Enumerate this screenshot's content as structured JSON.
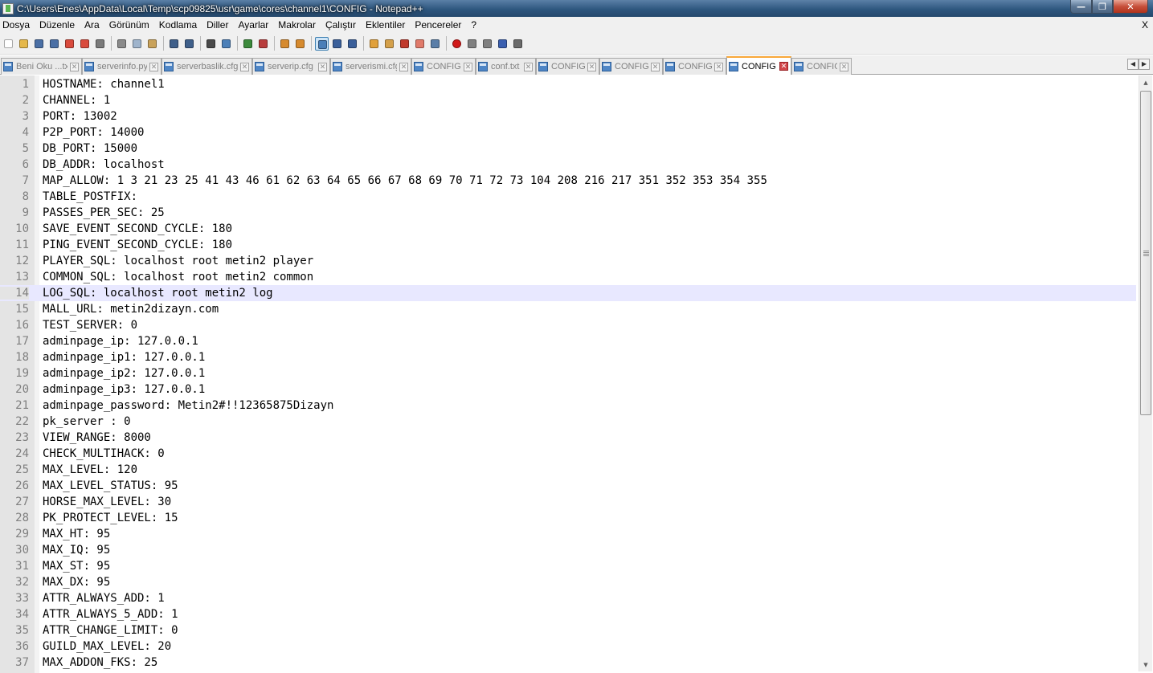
{
  "window": {
    "title": "C:\\Users\\Enes\\AppData\\Local\\Temp\\scp09825\\usr\\game\\cores\\channel1\\CONFIG - Notepad++",
    "app_icon": "notepadpp-icon"
  },
  "menu": {
    "items": [
      "Dosya",
      "Düzenle",
      "Ara",
      "Görünüm",
      "Kodlama",
      "Diller",
      "Ayarlar",
      "Makrolar",
      "Çalıştır",
      "Eklentiler",
      "Pencereler",
      "?"
    ],
    "close_label": "X"
  },
  "toolbar": {
    "buttons": [
      {
        "name": "new-file-icon",
        "color": "#ffffff"
      },
      {
        "name": "open-file-icon",
        "color": "#e5b84a"
      },
      {
        "name": "save-icon",
        "color": "#4a6fa5"
      },
      {
        "name": "save-all-icon",
        "color": "#4a6fa5"
      },
      {
        "name": "close-icon",
        "color": "#d94a3c"
      },
      {
        "name": "close-all-icon",
        "color": "#d94a3c"
      },
      {
        "name": "print-icon",
        "color": "#7a7a7a"
      },
      {
        "name": "cut-icon",
        "color": "#8a8a8a"
      },
      {
        "name": "copy-icon",
        "color": "#9fb4cc"
      },
      {
        "name": "paste-icon",
        "color": "#c9a25a"
      },
      {
        "name": "undo-icon",
        "color": "#3f5f8a"
      },
      {
        "name": "redo-icon",
        "color": "#3f5f8a"
      },
      {
        "name": "find-icon",
        "color": "#4a4a4a"
      },
      {
        "name": "replace-icon",
        "color": "#4b7fb8"
      },
      {
        "name": "zoom-in-icon",
        "color": "#3c8a3c"
      },
      {
        "name": "zoom-out-icon",
        "color": "#b83c3c"
      },
      {
        "name": "sync-vertical-icon",
        "color": "#d68a2e"
      },
      {
        "name": "sync-horizontal-icon",
        "color": "#d68a2e"
      },
      {
        "name": "word-wrap-icon",
        "color": "#4b7fb8"
      },
      {
        "name": "show-all-chars-icon",
        "color": "#3a5f9a"
      },
      {
        "name": "indent-guide-icon",
        "color": "#3a5f9a"
      },
      {
        "name": "user-lang-icon",
        "color": "#e0a03a"
      },
      {
        "name": "doc-map-icon",
        "color": "#d4a04a"
      },
      {
        "name": "function-list-icon",
        "color": "#c0392b"
      },
      {
        "name": "folder-workspace-icon",
        "color": "#e07a6a"
      },
      {
        "name": "monitoring-eye-icon",
        "color": "#5a7ea8"
      },
      {
        "name": "macro-record-icon",
        "color": "#d01818"
      },
      {
        "name": "macro-stop-icon",
        "color": "#808080"
      },
      {
        "name": "macro-play-icon",
        "color": "#808080"
      },
      {
        "name": "macro-run-multiple-icon",
        "color": "#3a5fb0"
      },
      {
        "name": "macro-save-icon",
        "color": "#6a6a6a"
      }
    ]
  },
  "tabs": [
    {
      "label": "Beni Oku ...txt",
      "active": false
    },
    {
      "label": "serverinfo.py",
      "active": false
    },
    {
      "label": "serverbaslik.cfg",
      "active": false
    },
    {
      "label": "serverip.cfg",
      "active": false
    },
    {
      "label": "serverismi.cfg",
      "active": false
    },
    {
      "label": "CONFIG",
      "active": false
    },
    {
      "label": "conf.txt",
      "active": false
    },
    {
      "label": "CONFIG",
      "active": false
    },
    {
      "label": "CONFIG",
      "active": false
    },
    {
      "label": "CONFIG",
      "active": false
    },
    {
      "label": "CONFIG",
      "active": true
    },
    {
      "label": "CONFIG",
      "active": false
    }
  ],
  "tab_widths": [
    101,
    99,
    113,
    97,
    101,
    80,
    75,
    79,
    79,
    79,
    81,
    75
  ],
  "editor": {
    "current_line": 14,
    "lines": [
      "HOSTNAME: channel1",
      "CHANNEL: 1",
      "PORT: 13002",
      "P2P_PORT: 14000",
      "DB_PORT: 15000",
      "DB_ADDR: localhost",
      "MAP_ALLOW: 1 3 21 23 25 41 43 46 61 62 63 64 65 66 67 68 69 70 71 72 73 104 208 216 217 351 352 353 354 355",
      "TABLE_POSTFIX:",
      "PASSES_PER_SEC: 25",
      "SAVE_EVENT_SECOND_CYCLE: 180",
      "PING_EVENT_SECOND_CYCLE: 180",
      "PLAYER_SQL: localhost root metin2 player",
      "COMMON_SQL: localhost root metin2 common",
      "LOG_SQL: localhost root metin2 log",
      "MALL_URL: metin2dizayn.com",
      "TEST_SERVER: 0",
      "adminpage_ip: 127.0.0.1",
      "adminpage_ip1: 127.0.0.1",
      "adminpage_ip2: 127.0.0.1",
      "adminpage_ip3: 127.0.0.1",
      "adminpage_password: Metin2#!!12365875Dizayn",
      "pk_server : 0",
      "VIEW_RANGE: 8000",
      "CHECK_MULTIHACK: 0",
      "MAX_LEVEL: 120",
      "MAX_LEVEL_STATUS: 95",
      "HORSE_MAX_LEVEL: 30",
      "PK_PROTECT_LEVEL: 15",
      "MAX_HT: 95",
      "MAX_IQ: 95",
      "MAX_ST: 95",
      "MAX_DX: 95",
      "ATTR_ALWAYS_ADD: 1",
      "ATTR_ALWAYS_5_ADD: 1",
      "ATTR_CHANGE_LIMIT: 0",
      "GUILD_MAX_LEVEL: 20",
      "MAX_ADDON_FKS: 25"
    ]
  },
  "colors": {
    "current_line_bg": "#e8e8ff",
    "active_tab_accent": "#f9a93a",
    "line_number_fg": "#808080"
  },
  "scrollbar": {
    "up_glyph": "▲",
    "down_glyph": "▼",
    "position_fraction": 0.0
  }
}
